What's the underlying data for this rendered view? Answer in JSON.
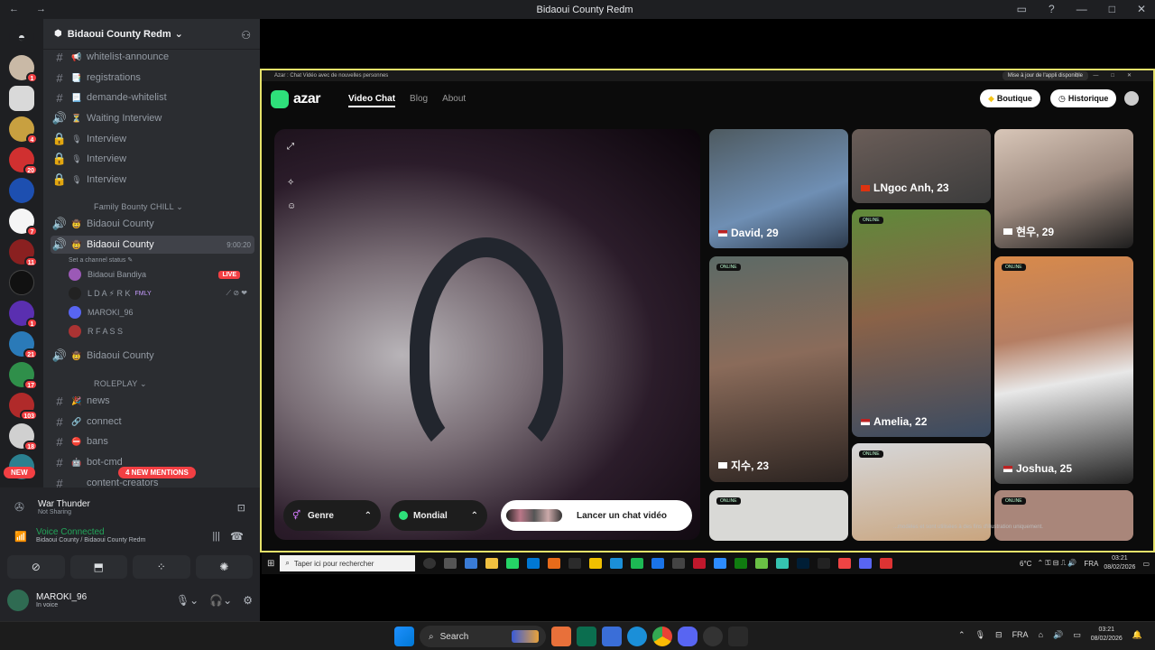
{
  "titlebar": {
    "title": "Bidaoui County Redm",
    "nav": "← →"
  },
  "guilds": {
    "new_label": "NEW",
    "badges": [
      "1",
      "",
      "4",
      "20",
      "",
      "7",
      "11",
      "",
      "1",
      "21",
      "17",
      "103",
      "18",
      "",
      ""
    ]
  },
  "sidebar": {
    "server_name": "Bidaoui County Redm",
    "channels": [
      {
        "type": "text",
        "icon": "📢",
        "label": "whitelist-announce"
      },
      {
        "type": "text",
        "icon": "📑",
        "label": "registrations"
      },
      {
        "type": "text",
        "icon": "📃",
        "label": "demande-whitelist"
      },
      {
        "type": "voice",
        "icon": "⏳",
        "label": "Waiting Interview"
      },
      {
        "type": "locked",
        "icon": "🎙",
        "label": "Interview"
      },
      {
        "type": "locked",
        "icon": "🎙",
        "label": "Interview"
      },
      {
        "type": "locked",
        "icon": "🎙",
        "label": "Interview"
      }
    ],
    "category_family": "Family Bounty CHILL",
    "voice1": "Bidaoui County",
    "voice_active": {
      "label": "Bidaoui County",
      "time": "9:00:20",
      "status_hint": "Set a channel status"
    },
    "voice_users": [
      {
        "name": "Bidaoui Bandiya",
        "live": "LIVE"
      },
      {
        "name": "L D A ⚡ R K",
        "tag": "FMLY"
      },
      {
        "name": "MAROKI_96"
      },
      {
        "name": "R F A S S"
      }
    ],
    "voice3": "Bidaoui County",
    "category_rp": "ROLEPLAY",
    "rp_channels": [
      {
        "icon": "🎉",
        "label": "news"
      },
      {
        "icon": "🔗",
        "label": "connect"
      },
      {
        "icon": "⛔",
        "label": "bans"
      },
      {
        "icon": "🤖",
        "label": "bot-cmd"
      },
      {
        "icon": "",
        "label": "content-creators"
      }
    ],
    "new_mentions": "4 NEW MENTIONS"
  },
  "panel": {
    "activity_title": "War Thunder",
    "activity_sub": "Not Sharing",
    "vc_title": "Voice Connected",
    "vc_sub": "Bidaoui County / Bidaoui County Redm",
    "username": "MAROKI_96",
    "user_status": "In voice"
  },
  "azar": {
    "window_title": "Azar : Chat Vidéo avec de nouvelles personnes",
    "update_label": "Mise à jour de l'appli disponible",
    "logo": "azar",
    "nav": [
      "Video Chat",
      "Blog",
      "About"
    ],
    "btn_shop": "Boutique",
    "btn_history": "Historique",
    "genre": "Genre",
    "mondial": "Mondial",
    "cta": "Lancer un chat vidéo",
    "online": "ONLINE",
    "tiles": [
      {
        "name": "David, 29"
      },
      {
        "name": "LNgoc Anh, 23"
      },
      {
        "name": "현우, 29"
      },
      {
        "name": "지수, 23"
      },
      {
        "name": "Amelia, 22"
      },
      {
        "name": "Joshua, 25"
      }
    ],
    "disclaimer": "...modèles et sont utilisées à des fins d'illustration uniquement."
  },
  "inner_taskbar": {
    "search": "Taper ici pour rechercher",
    "temp": "6°C",
    "lang": "FRA",
    "time": "03:21",
    "date": "08/02/2026"
  },
  "taskbar": {
    "search": "Search",
    "lang": "FRA",
    "time": "03:21",
    "date": "08/02/2026"
  },
  "colors": {
    "discord_bg": "#2b2d31",
    "azar_green": "#2ee07a",
    "live_red": "#f23f43",
    "stream_border": "#e6e26a"
  }
}
